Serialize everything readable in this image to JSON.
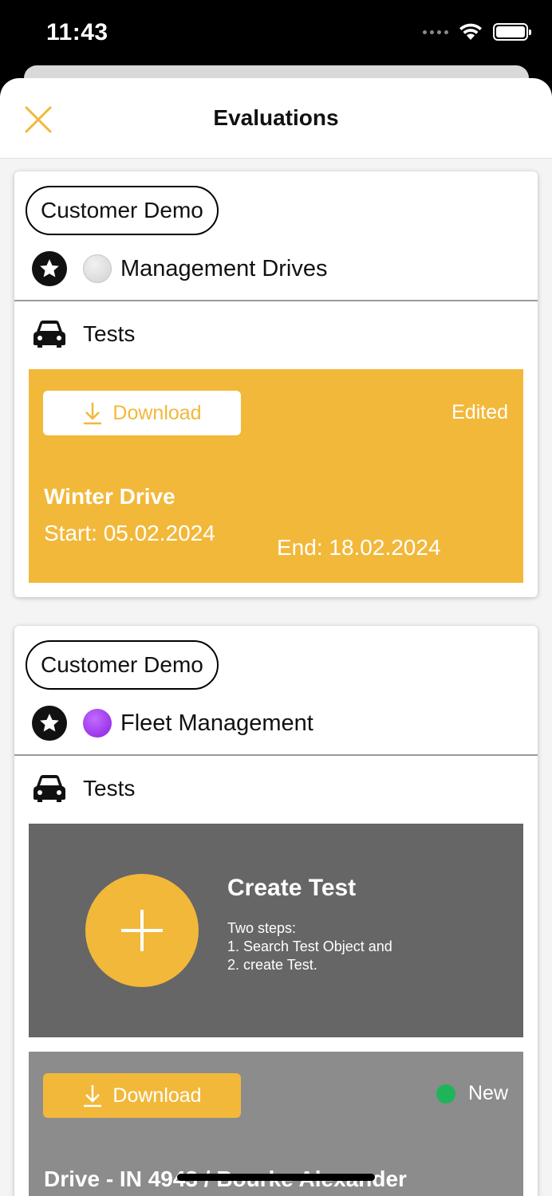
{
  "status_bar": {
    "time": "11:43"
  },
  "header": {
    "title": "Evaluations"
  },
  "cards": [
    {
      "customer": "Customer Demo",
      "project": "Management Drives",
      "tests_label": "Tests",
      "test": {
        "download_label": "Download",
        "status": "Edited",
        "name": "Winter Drive",
        "start": "Start: 05.02.2024",
        "end": "End: 18.02.2024"
      }
    },
    {
      "customer": "Customer Demo",
      "project": "Fleet Management",
      "tests_label": "Tests",
      "create_test": {
        "title": "Create Test",
        "line1": "Two steps:",
        "line2": "1. Search Test Object and",
        "line3": "2. create Test."
      },
      "test": {
        "download_label": "Download",
        "status": "New",
        "name": "Drive - IN 4943 / Bourke Alexander"
      }
    }
  ],
  "colors": {
    "accent": "#f2b83a",
    "status_new": "#1fb45a",
    "project_dot_1": "#d0d0d0",
    "project_dot_2": "#9a33f0"
  }
}
